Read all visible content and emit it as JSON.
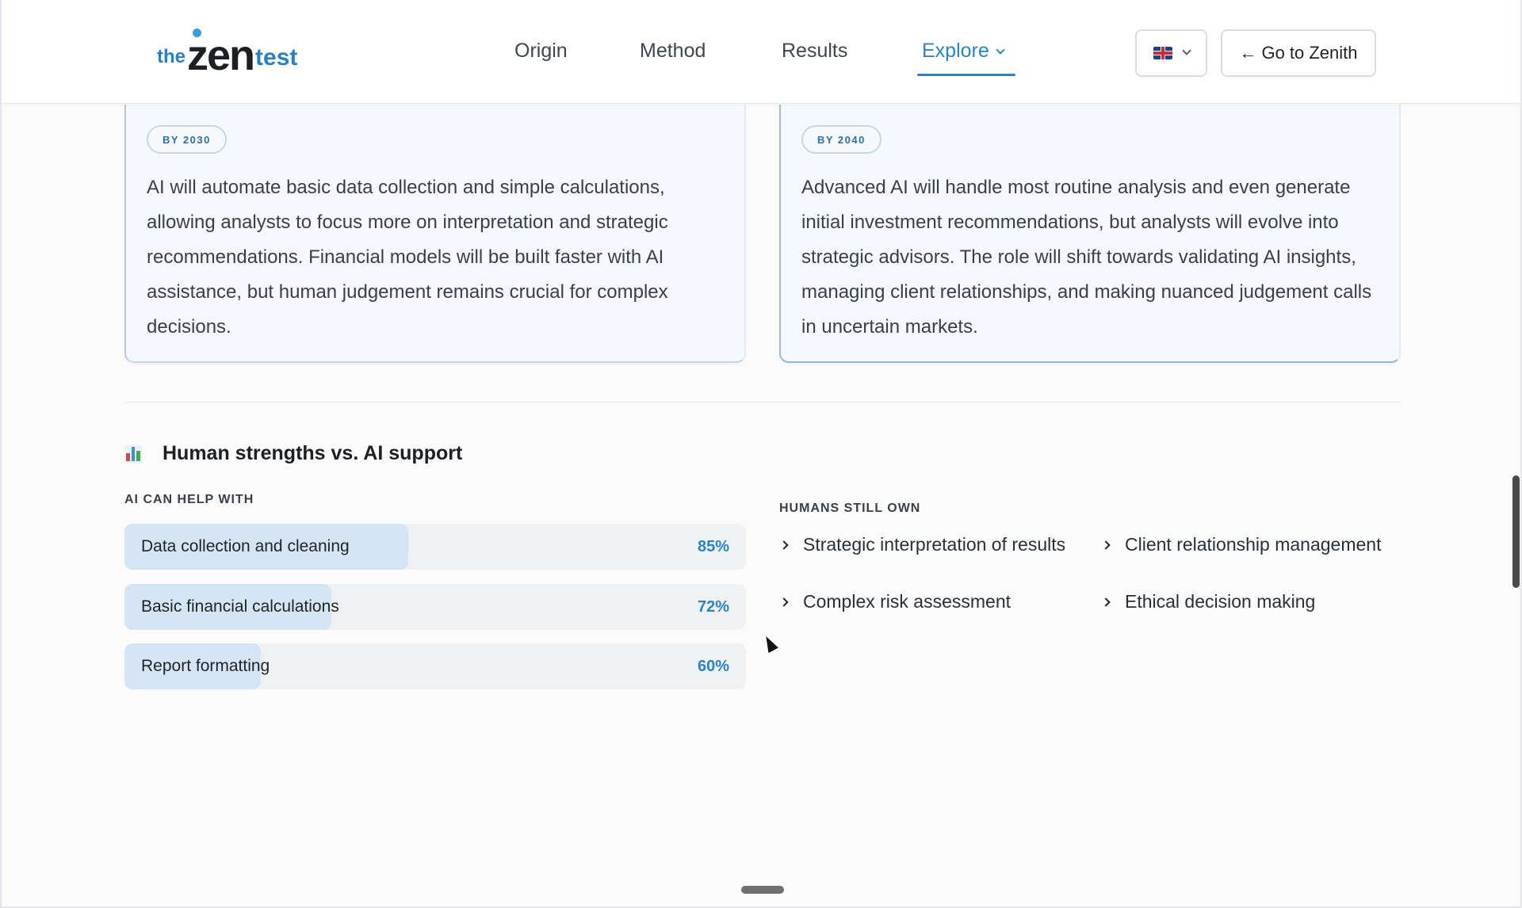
{
  "header": {
    "logo": {
      "the": "the",
      "zen": "zen",
      "test": "test"
    },
    "nav": [
      {
        "label": "Origin"
      },
      {
        "label": "Method"
      },
      {
        "label": "Results"
      },
      {
        "label": "Explore",
        "active": true,
        "has_dropdown": true
      }
    ],
    "language": {
      "flag": "uk-flag-icon",
      "icon": "chevron-down-icon"
    },
    "zenith_button": {
      "arrow": "←",
      "label": "Go to Zenith"
    }
  },
  "cards": [
    {
      "badge": "BY 2030",
      "text": "AI will automate basic data collection and simple calculations, allowing analysts to focus more on interpretation and strategic recommendations. Financial models will be built faster with AI assistance, but human judgement remains crucial for complex decisions."
    },
    {
      "badge": "BY 2040",
      "text": "Advanced AI will handle most routine analysis and even generate initial investment recommendations, but analysts will evolve into strategic advisors. The role will shift towards validating AI insights, managing client relationships, and making nuanced judgement calls in uncertain markets."
    }
  ],
  "section": {
    "icon": "bar-chart-icon",
    "title": "Human strengths vs. AI support",
    "ai_label": "AI CAN HELP WITH",
    "ai_items": [
      {
        "label": "Data collection and cleaning",
        "percent": "85%",
        "value": 85
      },
      {
        "label": "Basic financial calculations",
        "percent": "72%",
        "value": 72
      },
      {
        "label": "Report formatting",
        "percent": "60%",
        "value": 60
      }
    ],
    "humans_label": "HUMANS STILL OWN",
    "human_items": [
      {
        "label": "Strategic interpretation of results"
      },
      {
        "label": "Client relationship management"
      },
      {
        "label": "Complex risk assessment"
      },
      {
        "label": "Ethical decision making"
      }
    ]
  },
  "colors": {
    "accent": "#2b84c7",
    "bar_fill": "#d6e5f4",
    "bar_track": "#f0f1f3"
  }
}
